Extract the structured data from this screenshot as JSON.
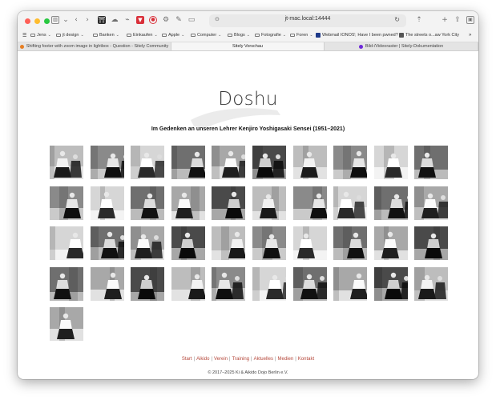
{
  "browser": {
    "url": "jt-mac.local:14444",
    "bookmarks": [
      {
        "label": "Jens",
        "type": "folder"
      },
      {
        "label": "jt design",
        "type": "folder"
      },
      {
        "label": "Banken",
        "type": "folder"
      },
      {
        "label": "Einkaufen",
        "type": "folder"
      },
      {
        "label": "Apple",
        "type": "folder"
      },
      {
        "label": "Computer",
        "type": "folder"
      },
      {
        "label": "Blogs",
        "type": "folder"
      },
      {
        "label": "Fotografie",
        "type": "folder"
      },
      {
        "label": "Foren",
        "type": "folder"
      },
      {
        "label": "Webmail IONOS",
        "type": "link"
      },
      {
        "label": "Have I been pwned?",
        "type": "link"
      },
      {
        "label": "The streets o...aw York City",
        "type": "link"
      }
    ],
    "tabs": [
      {
        "label": "Shifting footer with zoom image in lightbox - Question - Sitely Community",
        "active": false
      },
      {
        "label": "Sitely Vorschau",
        "active": true
      },
      {
        "label": "Bild-/Videoraster | Sitely-Dokumentation",
        "active": false
      }
    ]
  },
  "page": {
    "title": "Doshu",
    "subtitle": "Im Gedenken an unseren Lehrer Kenjiro Yoshigasaki Sensei (1951–2021)",
    "gallery_count": 41,
    "footer_links": [
      "Start",
      "Aikido",
      "Verein",
      "Training",
      "Aktuelles",
      "Medien",
      "Kontakt"
    ],
    "copyright": "© 2017–2025 Ki & Aikido Dojo Berlin e.V."
  }
}
